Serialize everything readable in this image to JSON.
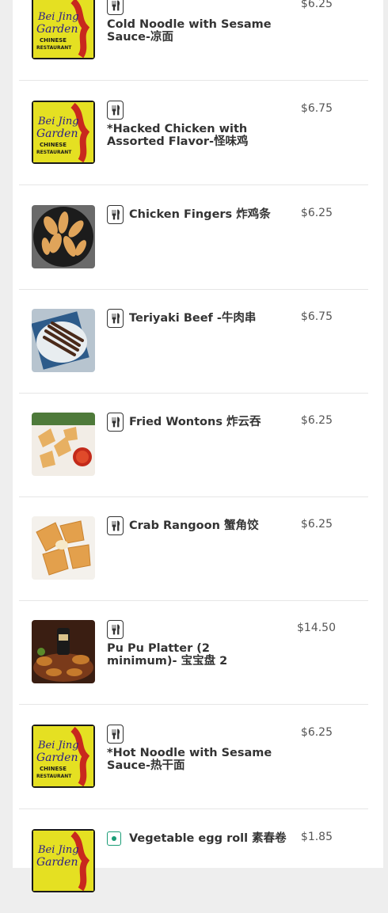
{
  "items": [
    {
      "name": "Cold Noodle with Sesame Sauce-凉面",
      "price": "$6.25",
      "image": "restaurant-logo",
      "badge": "utensils"
    },
    {
      "name": "*Hacked Chicken with Assorted Flavor-怪味鸡",
      "price": "$6.75",
      "image": "restaurant-logo",
      "badge": "utensils"
    },
    {
      "name": "Chicken Fingers 炸鸡条",
      "price": "$6.25",
      "image": "chicken-fingers",
      "badge": "utensils"
    },
    {
      "name": "Teriyaki Beef -牛肉串",
      "price": "$6.75",
      "image": "teriyaki-beef",
      "badge": "utensils"
    },
    {
      "name": "Fried Wontons 炸云吞",
      "price": "$6.25",
      "image": "fried-wontons",
      "badge": "utensils"
    },
    {
      "name": "Crab Rangoon 蟹角饺",
      "price": "$6.25",
      "image": "crab-rangoon",
      "badge": "utensils"
    },
    {
      "name": "Pu Pu Platter (2 minimum)- 宝宝盘 2",
      "price": "$14.50",
      "image": "pu-pu-platter",
      "badge": "utensils"
    },
    {
      "name": "*Hot Noodle with Sesame Sauce-热干面",
      "price": "$6.25",
      "image": "restaurant-logo",
      "badge": "utensils"
    },
    {
      "name": "Vegetable egg roll 素春卷",
      "price": "$1.85",
      "image": "restaurant-logo",
      "badge": "vegetarian"
    }
  ],
  "logo": {
    "line1": "Bei Jing",
    "line2": "Garden",
    "line3": "CHINESE",
    "line4": "RESTAURANT"
  }
}
